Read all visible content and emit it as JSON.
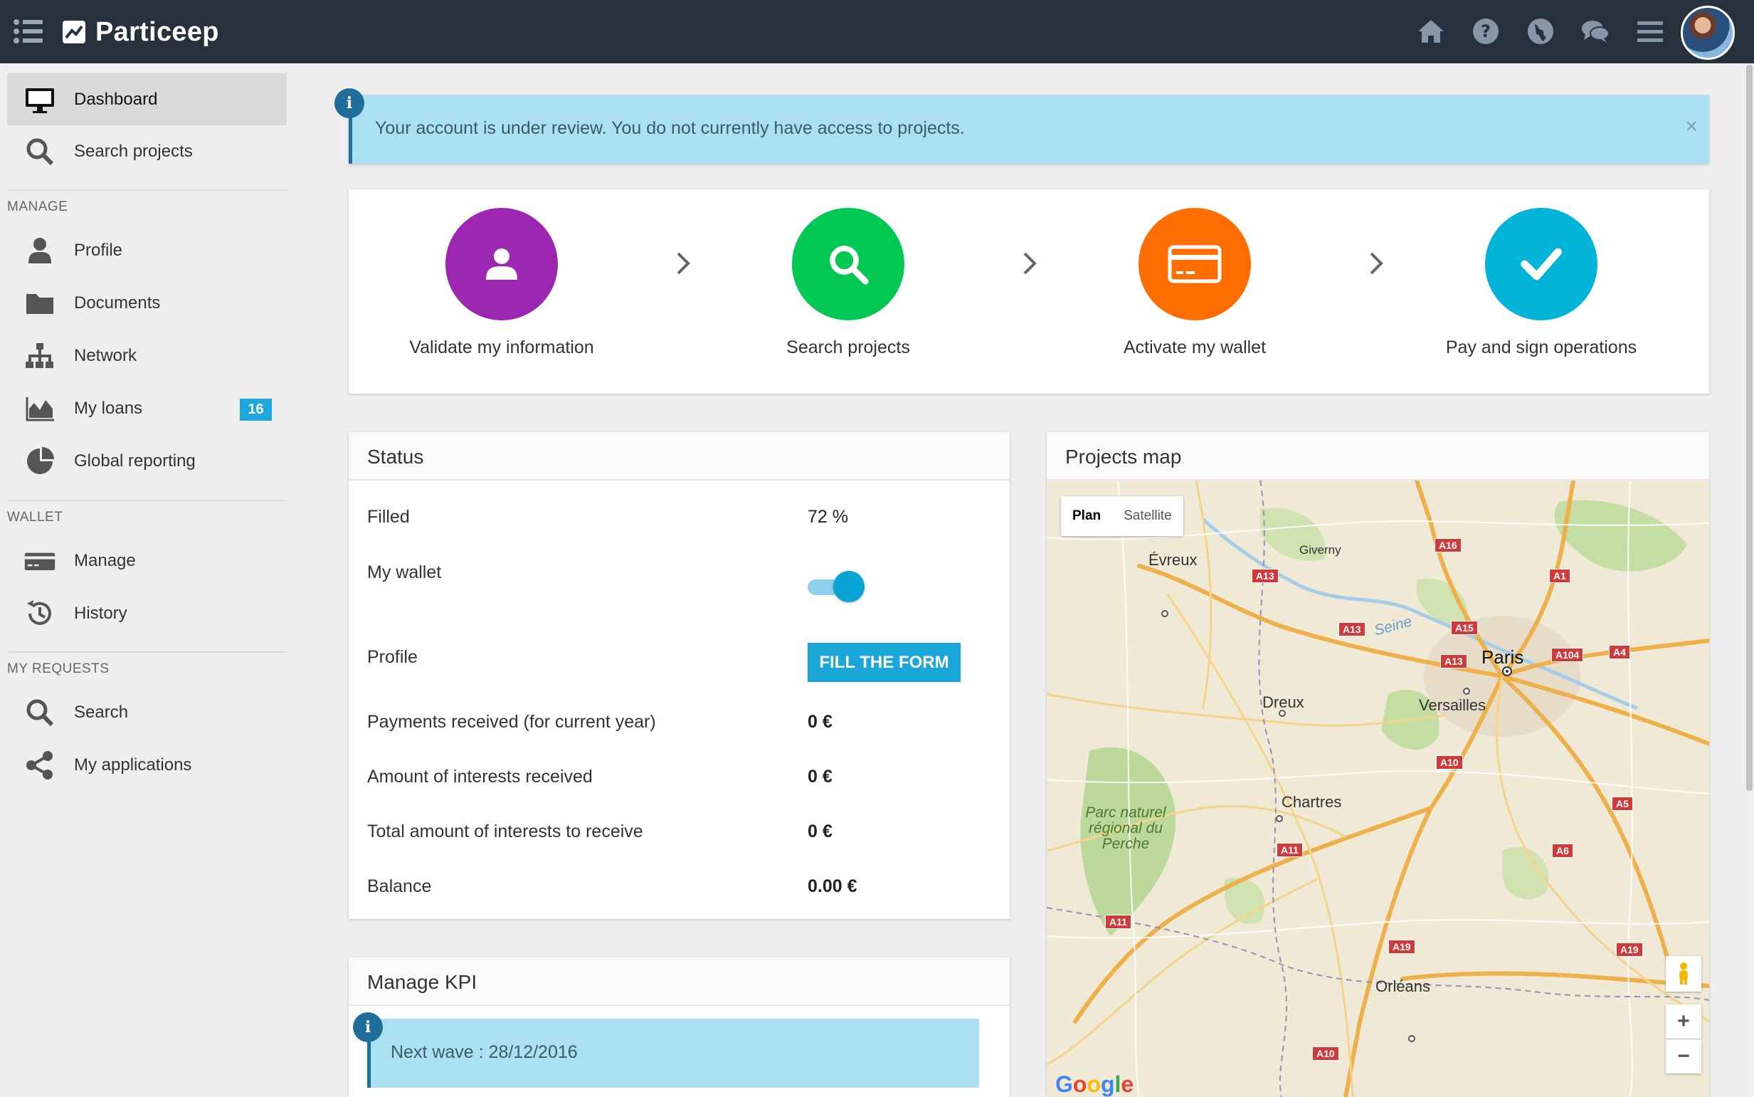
{
  "app": {
    "name": "Particeep",
    "top_icons": [
      "home-icon",
      "help-icon",
      "globe-icon",
      "chat-icon",
      "menu-icon"
    ]
  },
  "sidebar": {
    "top_items": [
      {
        "label": "Dashboard",
        "icon": "monitor-icon",
        "active": true
      },
      {
        "label": "Search projects",
        "icon": "search-icon"
      }
    ],
    "sections": [
      {
        "title": "MANAGE",
        "items": [
          {
            "label": "Profile",
            "icon": "user-icon"
          },
          {
            "label": "Documents",
            "icon": "folder-icon"
          },
          {
            "label": "Network",
            "icon": "network-icon"
          },
          {
            "label": "My loans",
            "icon": "area-chart-icon",
            "badge": "16"
          },
          {
            "label": "Global reporting",
            "icon": "pie-chart-icon"
          }
        ]
      },
      {
        "title": "WALLET",
        "items": [
          {
            "label": "Manage",
            "icon": "credit-card-icon"
          },
          {
            "label": "History",
            "icon": "history-icon"
          }
        ]
      },
      {
        "title": "MY REQUESTS",
        "items": [
          {
            "label": "Search",
            "icon": "search-icon"
          },
          {
            "label": "My applications",
            "icon": "share-icon"
          }
        ]
      }
    ]
  },
  "alert": {
    "text": "Your account is under review. You do not currently have access to projects.",
    "close": "×"
  },
  "steps": [
    {
      "label": "Validate my information",
      "color": "#9c27b0",
      "icon": "user-icon"
    },
    {
      "label": "Search projects",
      "color": "#00c853",
      "icon": "search-icon"
    },
    {
      "label": "Activate my wallet",
      "color": "#ff6d00",
      "icon": "credit-card-icon"
    },
    {
      "label": "Pay and sign operations",
      "color": "#00b4d8",
      "icon": "check-icon"
    }
  ],
  "status": {
    "title": "Status",
    "rows": [
      {
        "label": "Filled",
        "value": "72 %"
      },
      {
        "label": "My wallet",
        "value": "",
        "toggle": true
      },
      {
        "label": "Profile",
        "button": "FILL THE FORM"
      },
      {
        "label": "Payments received (for current year)",
        "value": "0 €"
      },
      {
        "label": "Amount of interests received",
        "value": "0 €"
      },
      {
        "label": "Total amount of interests to receive",
        "value": "0 €"
      },
      {
        "label": "Balance",
        "value": "0.00 €"
      }
    ]
  },
  "kpi": {
    "title": "Manage KPI",
    "alert_text": "Next wave : 28/12/2016"
  },
  "map": {
    "title": "Projects map",
    "tabs": [
      "Plan",
      "Satellite"
    ],
    "cities": [
      "Évreux",
      "Giverny",
      "Paris",
      "Versailles",
      "Dreux",
      "Chartres",
      "Orléans"
    ],
    "park": "Parc naturel régional du Perche",
    "river": "Seine",
    "roads": [
      "A16",
      "A13",
      "A1",
      "A15",
      "A104",
      "A4",
      "A13",
      "A13",
      "A10",
      "A5",
      "A11",
      "A6",
      "A11",
      "A19",
      "A19",
      "A10"
    ],
    "zoom_in": "+",
    "zoom_out": "−",
    "google": "Google"
  },
  "colors": {
    "topbar": "#26313d",
    "accent": "#1aa6d8",
    "alert_bg": "#abe0f2"
  }
}
